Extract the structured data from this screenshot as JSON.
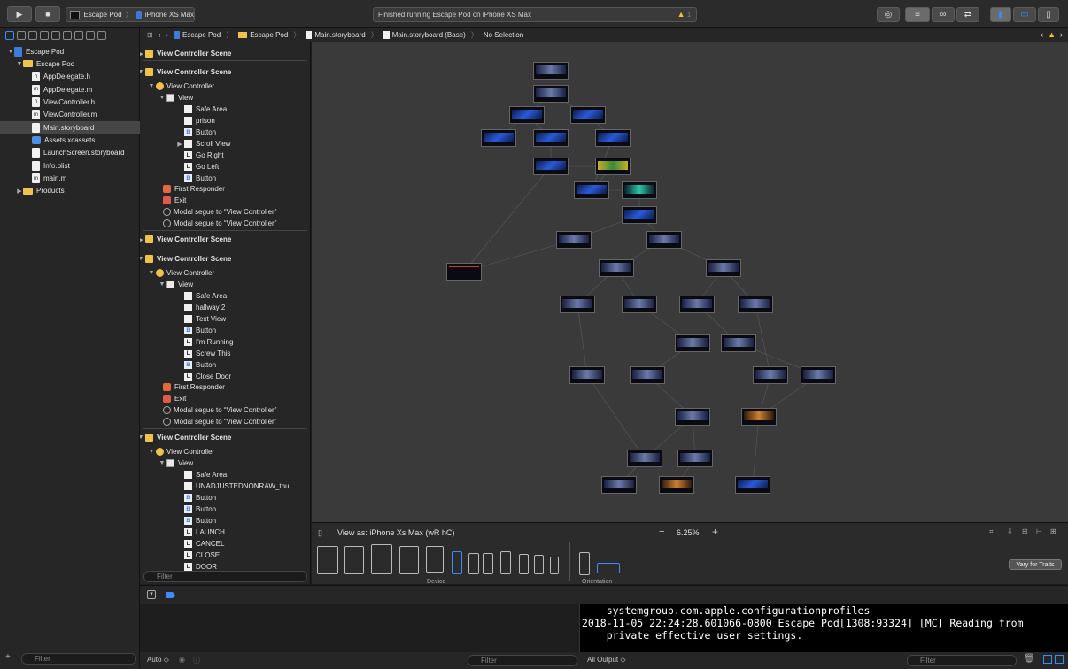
{
  "toolbar": {
    "scheme_app": "Escape Pod",
    "scheme_device": "iPhone XS Max",
    "status": "Finished running Escape Pod on iPhone XS Max",
    "warning_icon": "warning-icon"
  },
  "navigator": {
    "items": [
      {
        "label": "Escape Pod",
        "kind": "project"
      },
      {
        "label": "Escape Pod",
        "kind": "folder"
      },
      {
        "label": "AppDelegate.h",
        "kind": "file",
        "badge": "h"
      },
      {
        "label": "AppDelegate.m",
        "kind": "file",
        "badge": "m"
      },
      {
        "label": "ViewController.h",
        "kind": "file",
        "badge": "h"
      },
      {
        "label": "ViewController.m",
        "kind": "file",
        "badge": "m"
      },
      {
        "label": "Main.storyboard",
        "kind": "storyboard"
      },
      {
        "label": "Assets.xcassets",
        "kind": "assets"
      },
      {
        "label": "LaunchScreen.storyboard",
        "kind": "storyboard"
      },
      {
        "label": "Info.plist",
        "kind": "file",
        "badge": ""
      },
      {
        "label": "main.m",
        "kind": "file",
        "badge": "m"
      },
      {
        "label": "Products",
        "kind": "folder"
      }
    ],
    "filter_placeholder": "Filter"
  },
  "jumpbar": {
    "crumbs": [
      "Escape Pod",
      "Escape Pod",
      "Main.storyboard",
      "Main.storyboard (Base)",
      "No Selection"
    ]
  },
  "outline": {
    "rows": [
      {
        "text": "View Controller Scene",
        "type": "scene"
      },
      {
        "text": "View Controller Scene",
        "type": "scene"
      },
      {
        "text": "View Controller",
        "type": "vc"
      },
      {
        "text": "View",
        "type": "view"
      },
      {
        "text": "Safe Area",
        "type": "box"
      },
      {
        "text": "prison",
        "type": "box"
      },
      {
        "text": "Button",
        "type": "button"
      },
      {
        "text": "Scroll View",
        "type": "box"
      },
      {
        "text": "Go Right",
        "type": "label"
      },
      {
        "text": "Go Left",
        "type": "label"
      },
      {
        "text": "Button",
        "type": "button"
      },
      {
        "text": "First Responder",
        "type": "fr"
      },
      {
        "text": "Exit",
        "type": "exit"
      },
      {
        "text": "Modal segue to “View Controller”",
        "type": "segue"
      },
      {
        "text": "Modal segue to “View Controller”",
        "type": "segue"
      },
      {
        "text": "View Controller Scene",
        "type": "scene"
      },
      {
        "text": "View Controller Scene",
        "type": "scene"
      },
      {
        "text": "View Controller",
        "type": "vc"
      },
      {
        "text": "View",
        "type": "view"
      },
      {
        "text": "Safe Area",
        "type": "box"
      },
      {
        "text": "hallway 2",
        "type": "box"
      },
      {
        "text": "Text View",
        "type": "box"
      },
      {
        "text": "Button",
        "type": "button"
      },
      {
        "text": "I'm Running",
        "type": "label"
      },
      {
        "text": "Screw This",
        "type": "label"
      },
      {
        "text": "Button",
        "type": "button"
      },
      {
        "text": "Close Door",
        "type": "label"
      },
      {
        "text": "First Responder",
        "type": "fr"
      },
      {
        "text": "Exit",
        "type": "exit"
      },
      {
        "text": "Modal segue to “View Controller”",
        "type": "segue"
      },
      {
        "text": "Modal segue to “View Controller”",
        "type": "segue"
      },
      {
        "text": "View Controller Scene",
        "type": "scene"
      },
      {
        "text": "View Controller",
        "type": "vc"
      },
      {
        "text": "View",
        "type": "view"
      },
      {
        "text": "Safe Area",
        "type": "box"
      },
      {
        "text": "UNADJUSTEDNONRAW_thu...",
        "type": "box"
      },
      {
        "text": "Button",
        "type": "button"
      },
      {
        "text": "Button",
        "type": "button"
      },
      {
        "text": "Button",
        "type": "button"
      },
      {
        "text": "LAUNCH",
        "type": "label"
      },
      {
        "text": "CANCEL",
        "type": "label"
      },
      {
        "text": "CLOSE",
        "type": "label"
      },
      {
        "text": "DOOR",
        "type": "label"
      }
    ],
    "filter_placeholder": "Filter"
  },
  "canvas": {
    "view_as": "View as: iPhone Xs Max (wR hC)",
    "zoom": "6.25%",
    "device_label": "Device",
    "orientation_label": "Orientation",
    "vary_button": "Vary for Traits"
  },
  "console": {
    "lines": [
      "    systemgroup.com.apple.configurationprofiles",
      "2018-11-05 22:24:28.601066-0800 Escape Pod[1308:93324] [MC] Reading from",
      "    private effective user settings."
    ]
  },
  "debug_footer": {
    "auto": "Auto ◇",
    "vars_filter": "Filter",
    "output": "All Output ◇",
    "console_filter": "Filter"
  }
}
